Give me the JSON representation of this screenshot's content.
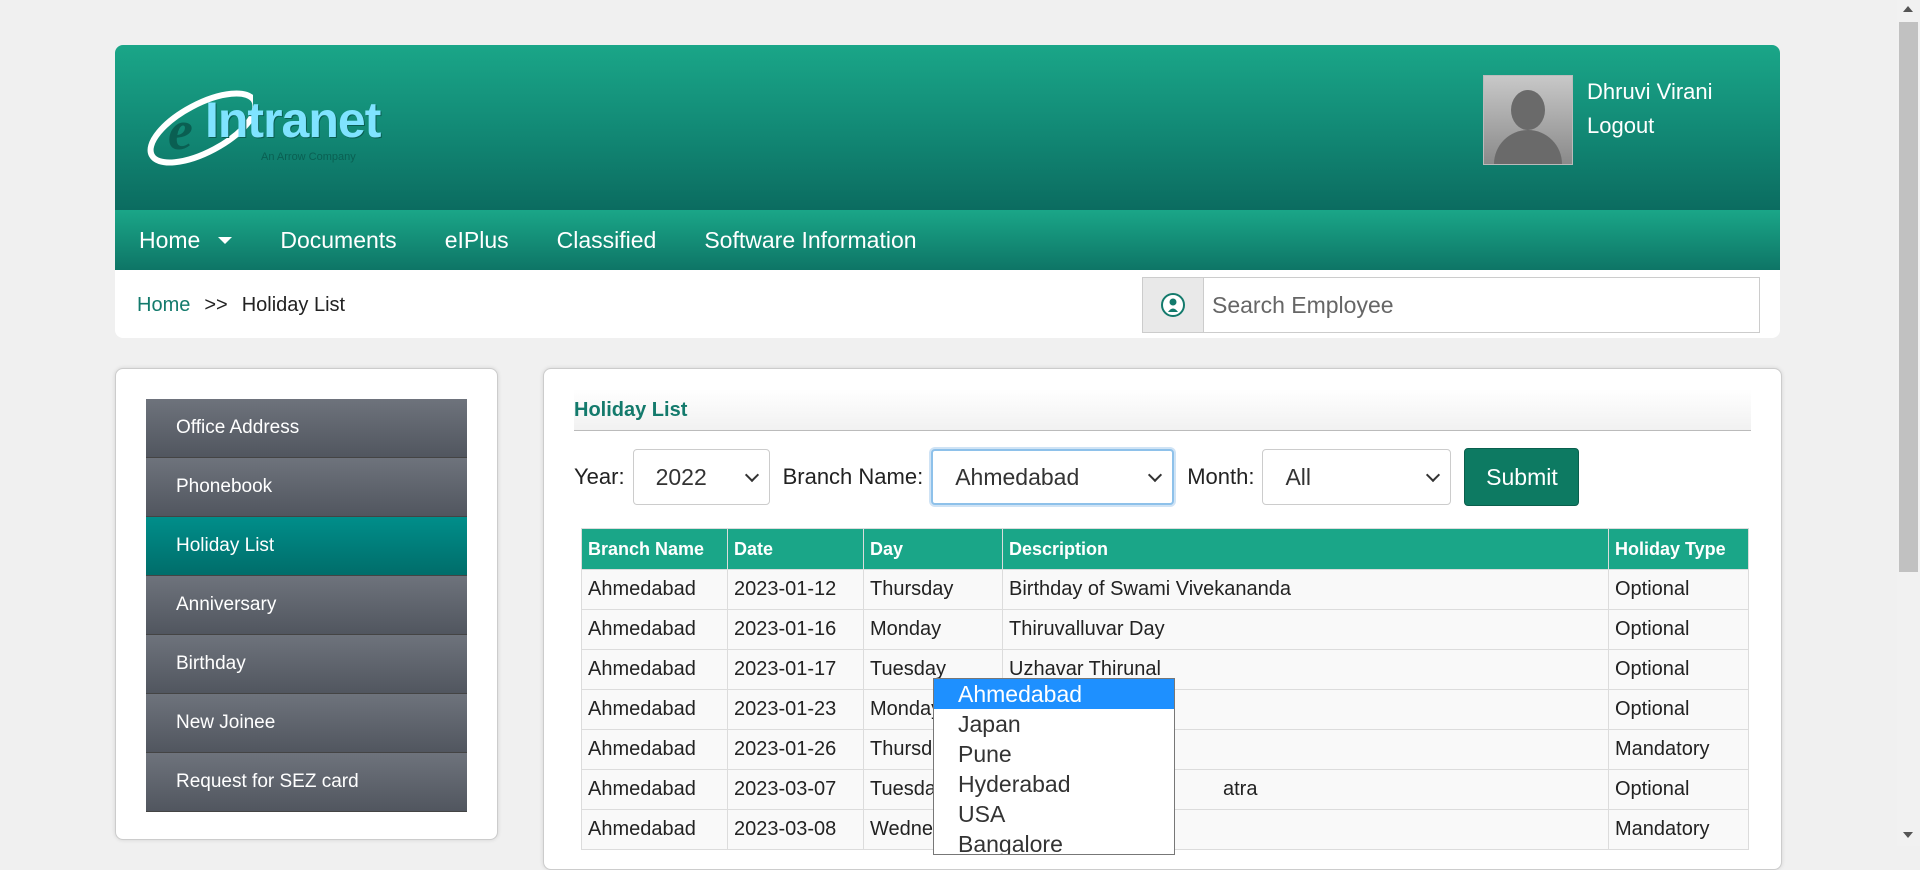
{
  "brand": {
    "logo_text": "Intranet",
    "logo_e": "e",
    "logo_sub": "An Arrow Company"
  },
  "user": {
    "name": "Dhruvi Virani",
    "logout_label": "Logout"
  },
  "nav": {
    "items": [
      {
        "label": "Home",
        "has_caret": true
      },
      {
        "label": "Documents"
      },
      {
        "label": "eIPlus"
      },
      {
        "label": "Classified"
      },
      {
        "label": "Software Information"
      }
    ]
  },
  "breadcrumb": {
    "home": "Home",
    "separator": ">>",
    "current": "Holiday List"
  },
  "search": {
    "placeholder": "Search Employee",
    "value": ""
  },
  "sidebar": {
    "items": [
      {
        "label": "Office Address"
      },
      {
        "label": "Phonebook"
      },
      {
        "label": "Holiday List",
        "active": true
      },
      {
        "label": "Anniversary"
      },
      {
        "label": "Birthday"
      },
      {
        "label": "New Joinee"
      },
      {
        "label": "Request for SEZ card"
      }
    ]
  },
  "panel": {
    "title": "Holiday List"
  },
  "filters": {
    "year_label": "Year:",
    "year_value": "2022",
    "branch_label": "Branch Name:",
    "branch_value": "Ahmedabad",
    "month_label": "Month:",
    "month_value": "All",
    "submit_label": "Submit"
  },
  "table": {
    "headers": [
      "Branch Name",
      "Date",
      "Day",
      "Description",
      "Holiday Type"
    ],
    "rows": [
      [
        "Ahmedabad",
        "2023-01-12",
        "Thursday",
        "Birthday of Swami Vivekananda",
        "Optional"
      ],
      [
        "Ahmedabad",
        "2023-01-16",
        "Monday",
        "Thiruvalluvar Day",
        "Optional"
      ],
      [
        "Ahmedabad",
        "2023-01-17",
        "Tuesday",
        "Uzhavar Thirunal",
        "Optional"
      ],
      [
        "Ahmedabad",
        "2023-01-23",
        "Monday",
        "",
        "Optional"
      ],
      [
        "Ahmedabad",
        "2023-01-26",
        "Thursd",
        "",
        "Mandatory"
      ],
      [
        "Ahmedabad",
        "2023-03-07",
        "Tuesda",
        "atra",
        "Optional"
      ],
      [
        "Ahmedabad",
        "2023-03-08",
        "Wedne",
        "",
        "Mandatory"
      ]
    ]
  },
  "branch_dropdown": {
    "options": [
      "Ahmedabad",
      "Japan",
      "Pune",
      "Hyderabad",
      "USA",
      "Bangalore"
    ],
    "selected": "Ahmedabad"
  },
  "icons": {
    "search_addon": "user-icon",
    "select_chevron": "chevron-down-icon"
  },
  "colors": {
    "header_top": "#1aa688",
    "header_bottom": "#0b6c60",
    "accent": "#137a6c",
    "submit": "#0d7a62",
    "dropdown_selected": "#1e90ff"
  }
}
